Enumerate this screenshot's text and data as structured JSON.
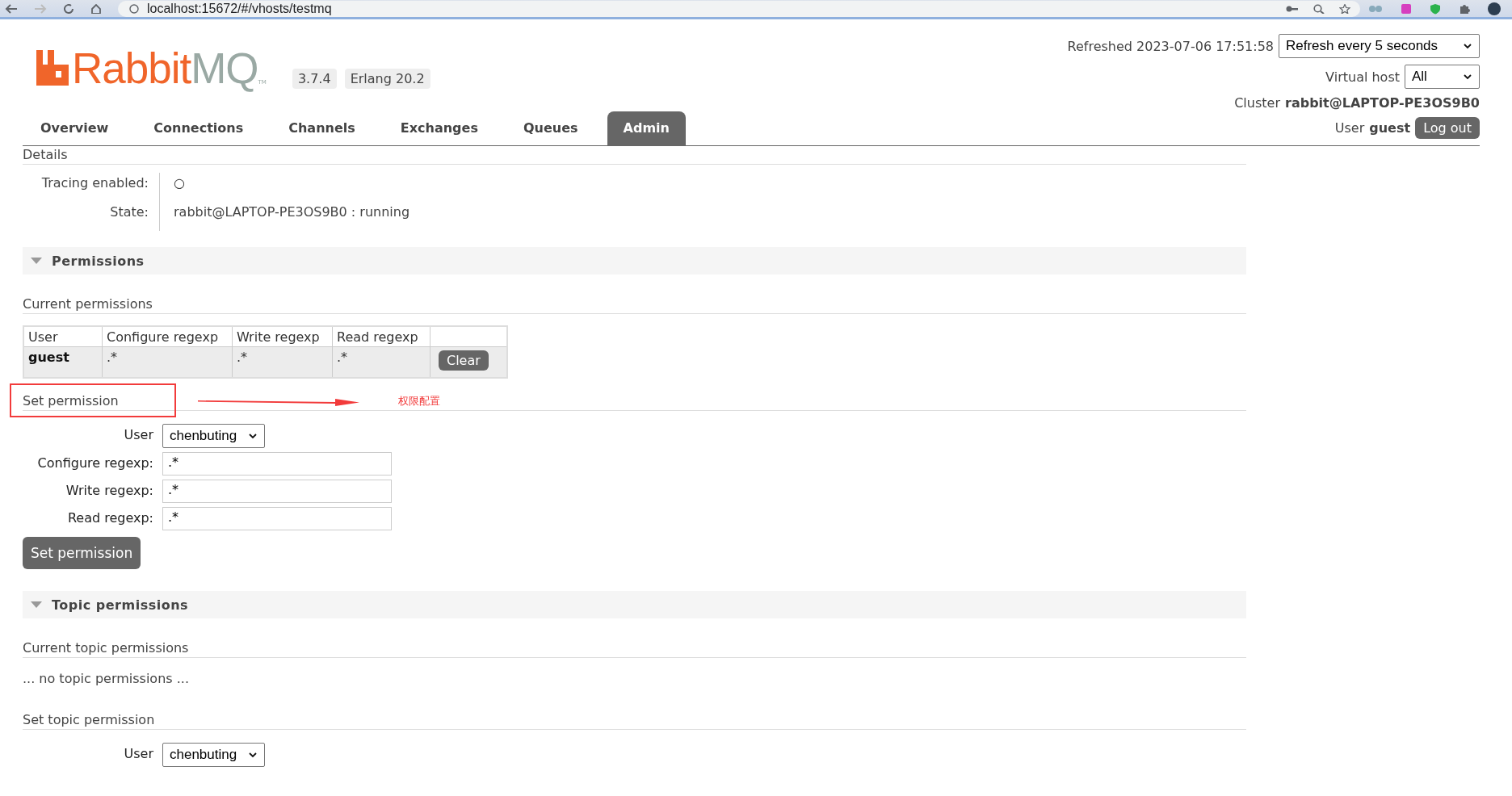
{
  "browser": {
    "url": "localhost:15672/#/vhosts/testmq"
  },
  "header": {
    "logo": {
      "brand": "Rabbit",
      "suffix": "MQ",
      "trademark": "TM"
    },
    "badges": [
      "3.7.4",
      "Erlang 20.2"
    ],
    "refreshed": "Refreshed 2023-07-06 17:51:58",
    "refresh_select": "Refresh every 5 seconds",
    "vhost_label": "Virtual host",
    "vhost_select": "All",
    "cluster_label": "Cluster",
    "cluster": "rabbit@LAPTOP-PE3OS9B0",
    "user_label": "User",
    "user": "guest",
    "logout": "Log out"
  },
  "tabs": [
    {
      "label": "Overview",
      "selected": false
    },
    {
      "label": "Connections",
      "selected": false
    },
    {
      "label": "Channels",
      "selected": false
    },
    {
      "label": "Exchanges",
      "selected": false
    },
    {
      "label": "Queues",
      "selected": false
    },
    {
      "label": "Admin",
      "selected": true
    }
  ],
  "details": {
    "title": "Details",
    "rows": [
      {
        "label": "Tracing enabled:",
        "value": "○"
      },
      {
        "label": "State:",
        "value": "rabbit@LAPTOP-PE3OS9B0 : running"
      }
    ]
  },
  "sections": [
    {
      "title": "Permissions",
      "expanded": true,
      "current_title": "Current permissions",
      "table": {
        "columns": [
          "User",
          "Configure regexp",
          "Write regexp",
          "Read regexp"
        ],
        "rows": [
          {
            "user": "guest",
            "configure": ".*",
            "write": ".*",
            "read": ".*",
            "action": "Clear"
          }
        ]
      },
      "set_title": "Set permission",
      "annotation": {
        "note": "权限配置"
      },
      "form": [
        {
          "kind": "select",
          "label": "User",
          "value": "chenbuting"
        },
        {
          "kind": "text",
          "label": "Configure regexp:",
          "value": ".*"
        },
        {
          "kind": "text",
          "label": "Write regexp:",
          "value": ".*"
        },
        {
          "kind": "text",
          "label": "Read regexp:",
          "value": ".*"
        }
      ],
      "button": "Set permission"
    },
    {
      "title": "Topic permissions",
      "expanded": true,
      "current_title": "Current topic permissions",
      "empty": "... no topic permissions ...",
      "set_title": "Set topic permission",
      "form": [
        {
          "kind": "select",
          "label": "User",
          "value": "chenbuting"
        }
      ]
    }
  ]
}
